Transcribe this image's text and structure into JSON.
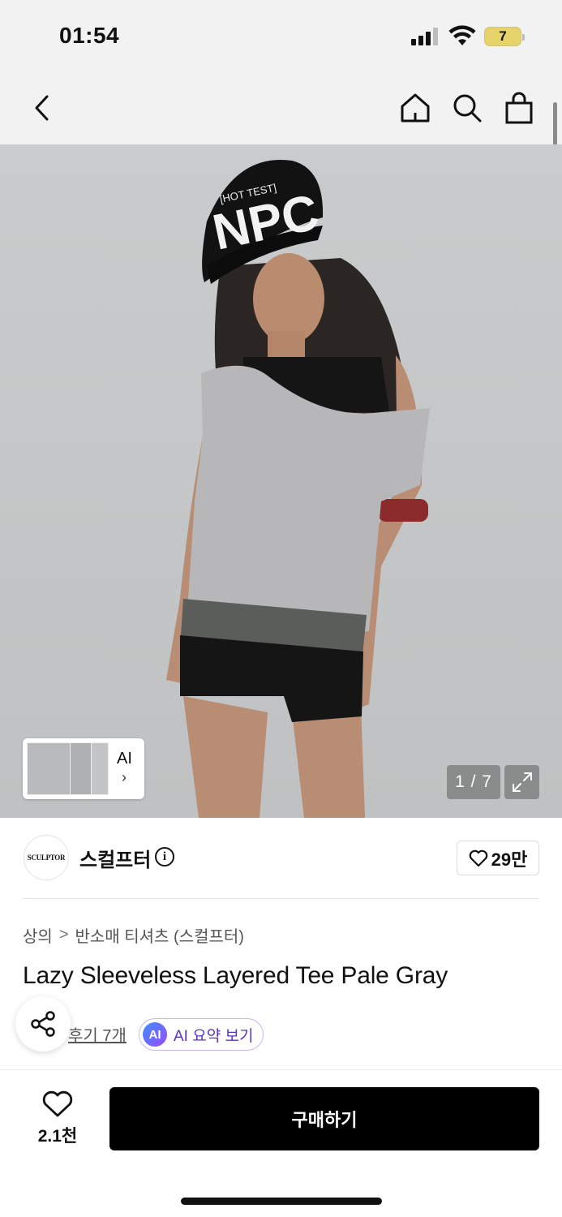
{
  "status_bar": {
    "time": "01:54",
    "battery": "7"
  },
  "nav": {
    "back_icon": "chevron-left-icon",
    "home_icon": "home-icon",
    "search_icon": "search-icon",
    "bag_icon": "shopping-bag-icon"
  },
  "gallery": {
    "thumb_label": "AI",
    "thumb_chevron": "›",
    "counter": "1 / 7",
    "cap_text_top": "[HOT TEST]",
    "cap_text_main": "NPC"
  },
  "brand": {
    "logo_text": "SCULPTOR",
    "name": "스컬프터",
    "info_symbol": "i",
    "likes": "29만"
  },
  "breadcrumb": {
    "category": "상의",
    "separator": ">",
    "subcategory": "반소매 티셔츠 (스컬프터)"
  },
  "product": {
    "title": "Lazy Sleeveless Layered Tee Pale Gray"
  },
  "reviews": {
    "link": "후기 7개",
    "ai_badge": "AI",
    "ai_summary": "AI 요약 보기"
  },
  "bottom": {
    "wish_count": "2.1천",
    "buy_label": "구매하기"
  },
  "colors": {
    "background": "#ffffff",
    "header_bg": "#f2f2f2",
    "buy_button": "#000000",
    "ai_accent": "#5a34c8"
  }
}
